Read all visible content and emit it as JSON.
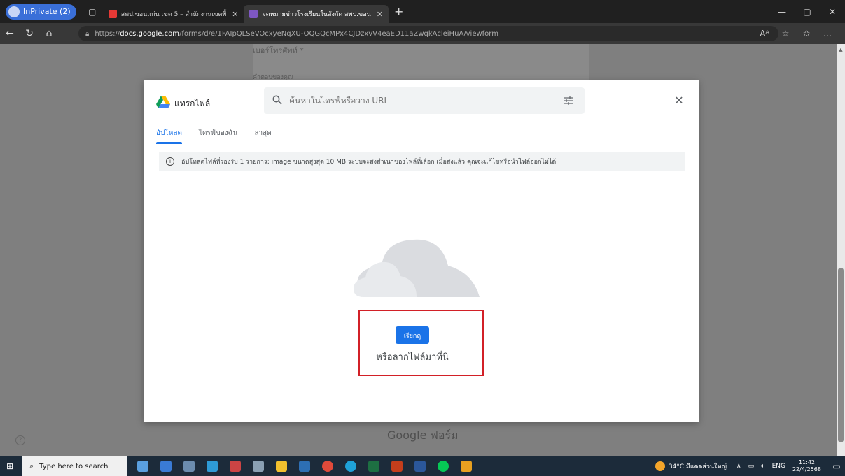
{
  "browser": {
    "profile_label": "InPrivate (2)",
    "tabs": [
      {
        "title": "สพป.ขอนแก่น เขต 5 – สำนักงานเขตพื้",
        "active": false
      },
      {
        "title": "จดหมายข่าวโรงเรียนในสังกัด สพป.ขอน",
        "active": true
      }
    ],
    "new_tab_glyph": "+",
    "url_prefix": "https://",
    "url_host": "docs.google.com",
    "url_path": "/forms/d/e/1FAIpQLSeVOcxyeNqXU-OQGQcMPx4CJDzxvV4eaED11aZwqkAcleiHuA/viewform"
  },
  "form_background": {
    "question_label": "เบอร์โทรศัพท์ *",
    "answer_placeholder": "คำตอบของคุณ",
    "footer": "Google ฟอร์ม"
  },
  "dialog": {
    "title": "แทรกไฟล์",
    "search_placeholder": "ค้นหาในไดรฟ์หรือวาง URL",
    "tabs": [
      "อัปโหลด",
      "ไดรฟ์ของฉัน",
      "ล่าสุด"
    ],
    "active_tab_index": 0,
    "info_text": "อัปโหลดไฟล์ที่รองรับ 1 รายการ: image ขนาดสูงสุด 10 MB ระบบจะส่งสำเนาของไฟล์ที่เลือก เมื่อส่งแล้ว คุณจะแก้ไขหรือนำไฟล์ออกไม่ได้",
    "browse_label": "เรียกดู",
    "drag_text": "หรือลากไฟล์มาที่นี่"
  },
  "taskbar": {
    "search_placeholder": "Type here to search",
    "weather": "34°C มีแดดส่วนใหญ่",
    "language": "ENG",
    "time": "11:42",
    "date": "22/4/2568"
  },
  "colors": {
    "accent": "#1a73e8",
    "highlight": "#d22027"
  }
}
